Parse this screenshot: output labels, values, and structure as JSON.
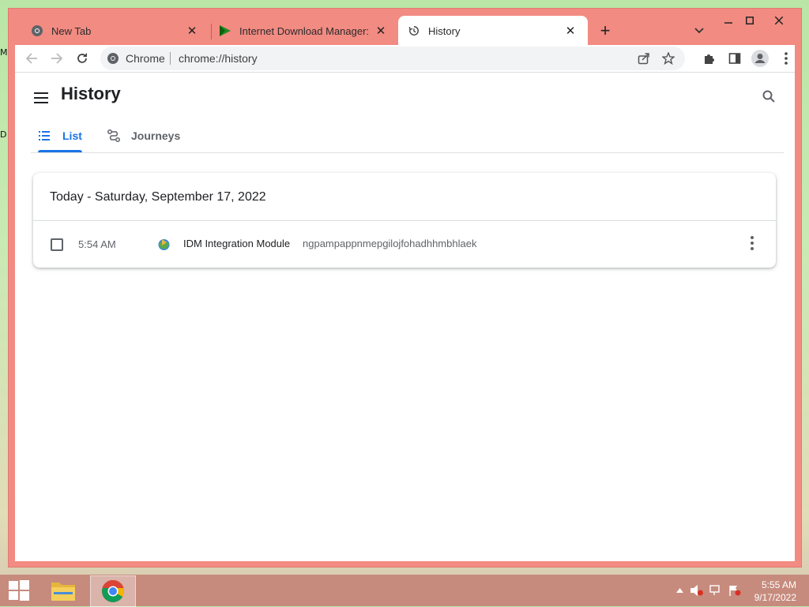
{
  "desktop": {
    "edge_letters": [
      "M",
      "D"
    ]
  },
  "tabs": [
    {
      "title": "New Tab",
      "icon": "chrome-icon",
      "close": "✕"
    },
    {
      "title": "Internet Download Manager: The",
      "icon": "idm-icon",
      "close": "✕"
    },
    {
      "title": "History",
      "icon": "history-icon",
      "close": "✕"
    }
  ],
  "new_tab": "+",
  "omnibox": {
    "chip": "Chrome",
    "url": "chrome://history"
  },
  "page": {
    "title": "History",
    "tabs": [
      {
        "label": "List"
      },
      {
        "label": "Journeys"
      }
    ],
    "active_tab": "List"
  },
  "history": {
    "day_header": "Today - Saturday, September 17, 2022",
    "entries": [
      {
        "time": "5:54 AM",
        "title": "IDM Integration Module",
        "domain": "ngpampappnmepgilojfohadhhmbhlaek"
      }
    ]
  },
  "taskbar": {
    "clock_time": "5:55 AM",
    "clock_date": "9/17/2022"
  },
  "colors": {
    "titlebar": "#f28b82",
    "accent": "#1a73e8"
  }
}
